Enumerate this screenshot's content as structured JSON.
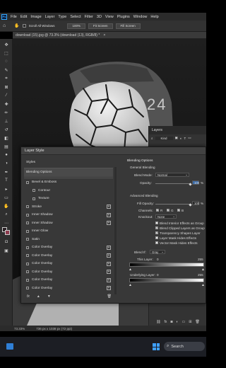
{
  "app": {
    "logo": "Ps"
  },
  "menu": [
    "File",
    "Edit",
    "Image",
    "Layer",
    "Type",
    "Select",
    "Filter",
    "3D",
    "View",
    "Plugins",
    "Window",
    "Help"
  ],
  "options_bar": {
    "scroll_all_windows": "Scroll All Windows",
    "zoom_100": "100%",
    "fit_screen": "Fit Screen",
    "fill_screen": "Fill Screen"
  },
  "document_tab": "download (15).jpg @ 73.3% (download (13), RGB/8) *",
  "canvas": {
    "overlay_number": "24"
  },
  "status": {
    "zoom": "73.33%",
    "doc_info": "736 px x 1038 px (72 ppi)"
  },
  "taskbar": {
    "search_label": "Search"
  },
  "layers_panel": {
    "title": "Layers",
    "kind": "Kind"
  },
  "layer_style": {
    "title": "Layer Style",
    "styles_header": "Styles",
    "items": [
      {
        "label": "Blending Options",
        "checkbox": false,
        "plus": false,
        "selected": true,
        "indent": false
      },
      {
        "label": "Bevel & Emboss",
        "checkbox": true,
        "plus": false,
        "selected": false,
        "indent": false
      },
      {
        "label": "Contour",
        "checkbox": true,
        "plus": false,
        "selected": false,
        "indent": true
      },
      {
        "label": "Texture",
        "checkbox": true,
        "plus": false,
        "selected": false,
        "indent": true
      },
      {
        "label": "Stroke",
        "checkbox": true,
        "plus": true,
        "selected": false,
        "indent": false
      },
      {
        "label": "Inner Shadow",
        "checkbox": true,
        "plus": true,
        "selected": false,
        "indent": false
      },
      {
        "label": "Inner Shadow",
        "checkbox": true,
        "plus": true,
        "selected": false,
        "indent": false
      },
      {
        "label": "Inner Glow",
        "checkbox": true,
        "plus": false,
        "selected": false,
        "indent": false
      },
      {
        "label": "Satin",
        "checkbox": true,
        "plus": false,
        "selected": false,
        "indent": false
      },
      {
        "label": "Color Overlay",
        "checkbox": true,
        "plus": true,
        "selected": false,
        "indent": false
      },
      {
        "label": "Color Overlay",
        "checkbox": true,
        "plus": true,
        "selected": false,
        "indent": false
      },
      {
        "label": "Color Overlay",
        "checkbox": true,
        "plus": true,
        "selected": false,
        "indent": false
      },
      {
        "label": "Color Overlay",
        "checkbox": true,
        "plus": true,
        "selected": false,
        "indent": false
      },
      {
        "label": "Color Overlay",
        "checkbox": true,
        "plus": true,
        "selected": false,
        "indent": false
      },
      {
        "label": "Color Overlay",
        "checkbox": true,
        "plus": true,
        "selected": false,
        "indent": false
      }
    ],
    "footer_fx": "fx",
    "blending": {
      "section": "Blending Options",
      "general": "General Blending",
      "blend_mode_label": "Blend Mode:",
      "blend_mode": "Normal",
      "opacity_label": "Opacity:",
      "opacity_value": "100",
      "opacity_unit": "%",
      "advanced": "Advanced Blending",
      "fill_opacity_label": "Fill Opacity:",
      "fill_opacity_value": "100",
      "fill_unit": "%",
      "channels_label": "Channels:",
      "ch_r": "R",
      "ch_g": "G",
      "ch_b": "B",
      "knockout_label": "Knockout:",
      "knockout": "None",
      "opt1": "Blend Interior Effects as Group",
      "opt2": "Blend Clipped Layers as Group",
      "opt3": "Transparency Shapes Layer",
      "opt4": "Layer Mask Hides Effects",
      "opt5": "Vector Mask Hides Effects",
      "blend_if_label": "Blend If:",
      "blend_if": "Gray",
      "this_layer_label": "This Layer:",
      "this_layer_min": "0",
      "this_layer_max": "255",
      "underlying_label": "Underlying Layer:",
      "underlying_min": "0",
      "underlying_max": "255"
    }
  }
}
